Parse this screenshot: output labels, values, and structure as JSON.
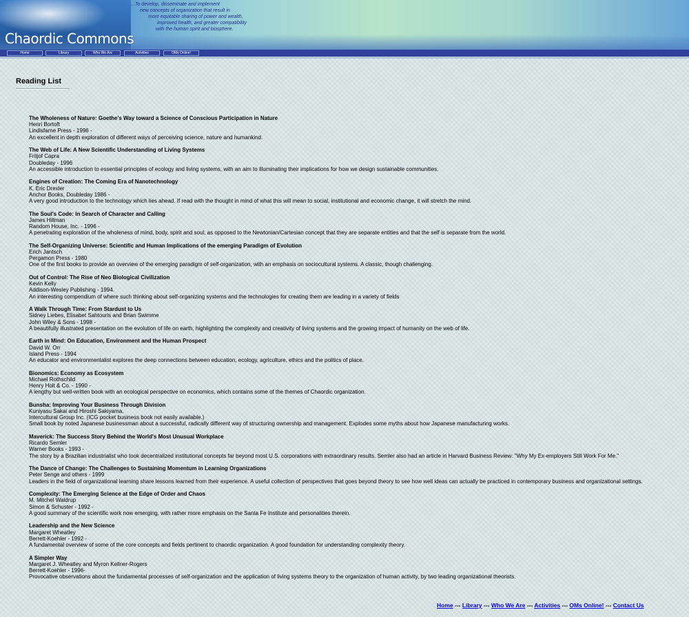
{
  "header": {
    "logo_text": "Chaordic Commons",
    "mission_lines": [
      "...To develop, disseminate and implement",
      "new concepts of organization that result in",
      "more equitable sharing of power and wealth,",
      "improved health, and greater compatibility",
      "with the human spirit and biosphere."
    ]
  },
  "nav": {
    "items": [
      "Home",
      "Library",
      "Who We Are",
      "Activities",
      "OMs Online!"
    ]
  },
  "page": {
    "title": "Reading List"
  },
  "books": [
    {
      "title": "The Wholeness of Nature: Goethe's Way toward a Science of Conscious Participation in Nature",
      "author": "Henri Bortoft",
      "publisher": "Lindisfarne Press - 1996 -",
      "description": "An excellent in depth exploration of different ways of perceiving science, nature and humankind."
    },
    {
      "title": "The Web of Life: A New Scientific Understanding of Living Systems",
      "author": "Fritjof Capra",
      "publisher": "Doubleday - 1996",
      "description": "An accessible introduction to essential principles of ecology and living systems, with an aim to illuminating their implications for how we design sustainable communities."
    },
    {
      "title": "Engines of Creation: The Coming Era of Nanotechnology",
      "author": "K. Eric Drexler",
      "publisher": "Anchor Books, Doubleday 1986 -",
      "description": "A very good introduction to the technology which lies ahead. If read with the thought in mind of what this will mean to social, institutional and economic change, it will stretch the mind."
    },
    {
      "title": "The Soul's Code: In Search of Character and Calling",
      "author": "James Hillman",
      "publisher": "Random House, Inc. - 1996 -",
      "description": "A penetrating exploration of the wholeness of mind, body, spirit and soul, as opposed to the Newtonian/Cartesian concept that they are separate entities and that the self is separate from the world."
    },
    {
      "title": "The Self-Organizing Universe: Scientific and Human Implications of the emerging Paradigm of Evolution",
      "author": "Erich Jantsch",
      "publisher": "Pergamon Press - 1980",
      "description": "One of the first books to provide an overview of the emerging paradigm of self-organization, with an emphasis on sociocultural systems. A classic, though challenging."
    },
    {
      "title": "Out of Control: The Rise of Neo Biological Civilization",
      "author": "Kevin Kelly",
      "publisher": "Addison-Wesley Publishing - 1994.",
      "description": "An interesting compendium of where such thinking about self-organizing systems and the technologies for creating them are leading in a variety of fields"
    },
    {
      "title": "A Walk Through Time: From Stardust to Us",
      "author": "Sidney Liebes, Elisabet Sahtouris and Brian Swimme",
      "publisher": "John Wiley & Sons - 1998 -",
      "description": "A beautifully illustrated presentation on the evolution of life on earth, highlighting the complexity and creativity of living systems and the growing impact of humanity on the web of life."
    },
    {
      "title": "Earth in Mind: On Education, Environment and the Human Prospect",
      "author": "David W. Orr",
      "publisher": "Island Press - 1994",
      "description": "An educator and environmentalist explores the deep connections between education, ecology, agriculture, ethics and the politics of place."
    },
    {
      "title": "Bionomics: Economy as Ecosystem",
      "author": "Michael Rothschild",
      "publisher": "Henry Holt & Co. - 1990 -",
      "description": "A lengthy but well-written book with an ecological perspective on economics, which contains some of the themes of Chaordic organization."
    },
    {
      "title": "Bunsha: Improving Your Business Through Division",
      "author": "Kuniyasu Sakai and Hiroshi Sakiyama.",
      "publisher": "Intercultural Group Inc. (ICG pocket business book not easily available.)",
      "description": "Small book by noted Japanese businessman about a successful, radically different way of structuring ownership and management. Explodes some myths about how Japanese manufacturing works."
    },
    {
      "title": "Maverick: The Success Story Behind the World's Most Unusual Workplace",
      "author": "Ricardo Semler",
      "publisher": "Warner Books - 1993 -",
      "description": "The story by a Brazilian industrialist who took decentralized institutional concepts far beyond most U.S. corporations with extraordinary results. Semler also had an article in Harvard Business Review: \"Why My Ex-employers Still Work For Me.\""
    },
    {
      "title": "The Dance of Change: The Challenges to Sustaining Momentum in Learning Organizations",
      "author": "Peter Senge and others - 1999",
      "publisher": "",
      "description": "Leaders in the field of organizational learning share lessons learned from their experience. A useful collection of perspectives that goes beyond theory to see how well ideas can actually be practiced in contemporary business and organizational settings."
    },
    {
      "title": "Complexity: The Emerging Science at the Edge of Order and Chaos",
      "author": "M. Mitchel Waldrup",
      "publisher": "Simon & Schuster - 1992 -",
      "description": "A good summary of the scientific work now emerging, with rather more emphasis on the Santa Fe Institute and personalities therein."
    },
    {
      "title": "Leadership and the New Science",
      "author": "Margaret Wheatley",
      "publisher": "Berrett-Koehler - 1992 -",
      "description": "A fundamental overview of some of the core concepts and fields pertinent to chaordic organization. A good foundation for understanding complexity theory."
    },
    {
      "title": "A Simpler Way",
      "author": "Margaret J. Wheatley and Myron Kellner-Rogers",
      "publisher": "Berrett-Koehler - 1996-",
      "description": "Provocative observations about the fundamental processes of self-organization and the application of living systems theory to the organization of human activity, by two leading organizational theorists."
    }
  ],
  "footer": {
    "links": [
      "Home",
      "Library",
      "Who We Are",
      "Activities",
      "OMs Online!",
      "Contact Us"
    ],
    "separator": " --- "
  }
}
